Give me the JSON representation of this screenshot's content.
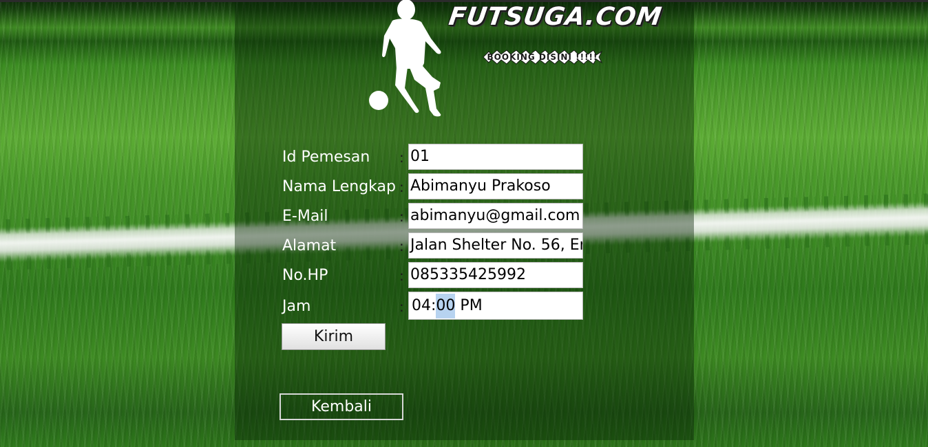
{
  "header": {
    "logo_title": "FUTSUGA.COM",
    "logo_subtitle": "BOOKING DISINI !!!!!"
  },
  "form": {
    "fields": [
      {
        "label": "Id Pemesan",
        "value": "01"
      },
      {
        "label": "Nama Lengkap",
        "value": "Abimanyu Prakoso"
      },
      {
        "label": "E-Mail",
        "value": "abimanyu@gmail.com"
      },
      {
        "label": "Alamat",
        "value": "Jalan Shelter No. 56, Er"
      },
      {
        "label": "No.HP",
        "value": "085335425992"
      }
    ],
    "time": {
      "label": "Jam",
      "hour": "04",
      "minute": "00",
      "period": "PM"
    },
    "separator": ":",
    "submit_label": "Kirim"
  },
  "footer": {
    "back_label": "Kembali"
  }
}
